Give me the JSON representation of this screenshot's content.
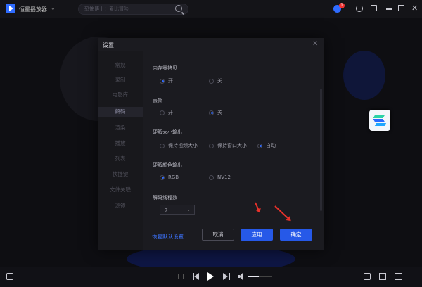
{
  "app": {
    "name": "恒星播放器"
  },
  "search": {
    "placeholder": "恐怖博士：爱比冒险"
  },
  "notifications": {
    "count": "1"
  },
  "dialog": {
    "title": "设置",
    "nav": [
      "常规",
      "录制",
      "电影库",
      "解码",
      "渲染",
      "播放",
      "列表",
      "快捷键",
      "文件关联",
      "滤镜"
    ],
    "active_nav": "解码",
    "sections": {
      "memory_zero_copy": {
        "title": "内存零拷贝",
        "options": [
          "开",
          "关"
        ],
        "selected": "开"
      },
      "drop_frames": {
        "title": "丢帧",
        "options": [
          "开",
          "关"
        ],
        "selected": "关"
      },
      "hw_decode_size": {
        "title": "硬解大小输出",
        "options": [
          "保持视频大小",
          "保持窗口大小",
          "自动"
        ],
        "selected": "自动"
      },
      "hw_decode_color": {
        "title": "硬解颜色输出",
        "options": [
          "RGB",
          "NV12"
        ],
        "selected": "RGB"
      },
      "decode_threads": {
        "title": "解码线程数",
        "value": "7"
      }
    },
    "reset_label": "恢复默认设置",
    "cancel_label": "取消",
    "apply_label": "应用",
    "ok_label": "确定"
  },
  "player": {
    "volume": 0.45
  },
  "colors": {
    "accent": "#2659e8",
    "arrow": "#e6312a",
    "background": "#0e0e12"
  },
  "icons": [
    "app-logo-icon",
    "chevron-down-icon",
    "search-icon",
    "bell-icon",
    "refresh-icon",
    "pin-icon",
    "minimize-icon",
    "maximize-icon",
    "close-icon",
    "add-file-icon",
    "stop-icon",
    "prev-icon",
    "play-icon",
    "next-icon",
    "volume-icon",
    "screen-icon",
    "playlist-icon",
    "menu-icon"
  ]
}
